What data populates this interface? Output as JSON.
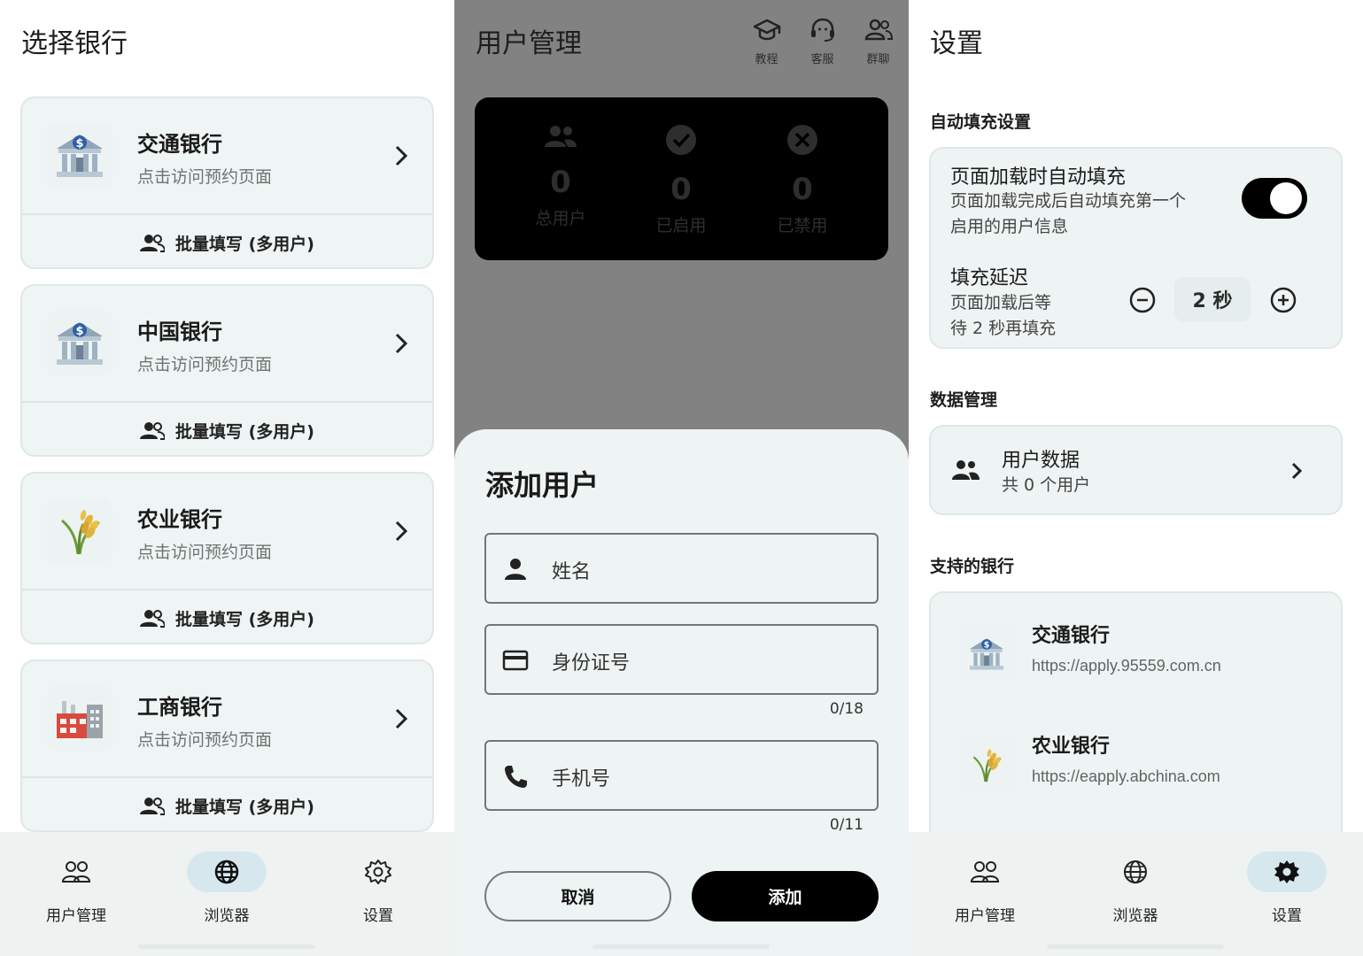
{
  "screen1": {
    "title": "选择银行",
    "banks": [
      {
        "name": "交通银行",
        "subtitle": "点击访问预约页面",
        "batch_label": "批量填写 (多用户)",
        "logo": "bank-building-icon"
      },
      {
        "name": "中国银行",
        "subtitle": "点击访问预约页面",
        "batch_label": "批量填写 (多用户)",
        "logo": "bank-building-icon"
      },
      {
        "name": "农业银行",
        "subtitle": "点击访问预约页面",
        "batch_label": "批量填写 (多用户)",
        "logo": "wheat-icon"
      },
      {
        "name": "工商银行",
        "subtitle": "点击访问预约页面",
        "batch_label": "批量填写 (多用户)",
        "logo": "factory-icon"
      }
    ],
    "nav": [
      {
        "label": "用户管理",
        "icon": "users-icon",
        "active": false
      },
      {
        "label": "浏览器",
        "icon": "globe-icon",
        "active": true
      },
      {
        "label": "设置",
        "icon": "gear-icon",
        "active": false
      }
    ]
  },
  "screen2": {
    "title": "用户管理",
    "actions": [
      {
        "label": "教程",
        "icon": "school-icon"
      },
      {
        "label": "客服",
        "icon": "headset-icon"
      },
      {
        "label": "群聊",
        "icon": "group-icon"
      }
    ],
    "stats": [
      {
        "value": "0",
        "label": "总用户",
        "icon": "people-icon"
      },
      {
        "value": "0",
        "label": "已启用",
        "icon": "check-circle-icon"
      },
      {
        "value": "0",
        "label": "已禁用",
        "icon": "x-circle-icon"
      }
    ],
    "sheet": {
      "title": "添加用户",
      "name_placeholder": "姓名",
      "id_placeholder": "身份证号",
      "id_counter": "0/18",
      "phone_placeholder": "手机号",
      "phone_counter": "0/11",
      "cancel_label": "取消",
      "add_label": "添加"
    }
  },
  "screen3": {
    "title": "设置",
    "autofill_section": "自动填充设置",
    "autofill_title": "页面加载时自动填充",
    "autofill_desc_1": "页面加载完成后自动填充第一个",
    "autofill_desc_2": "启用的用户信息",
    "autofill_enabled": true,
    "delay_title": "填充延迟",
    "delay_desc_1": "页面加载后等",
    "delay_desc_2": "待 2 秒再填充",
    "delay_value": "2 秒",
    "data_section": "数据管理",
    "user_data_title": "用户数据",
    "user_data_desc": "共 0 个用户",
    "supported_section": "支持的银行",
    "supported_banks": [
      {
        "name": "交通银行",
        "url": "https://apply.95559.com.cn",
        "logo": "bank-building-icon"
      },
      {
        "name": "农业银行",
        "url": "https://eapply.abchina.com",
        "logo": "wheat-icon"
      }
    ],
    "nav": [
      {
        "label": "用户管理",
        "icon": "users-icon",
        "active": false
      },
      {
        "label": "浏览器",
        "icon": "globe-icon",
        "active": false
      },
      {
        "label": "设置",
        "icon": "gear-icon",
        "active": true
      }
    ]
  },
  "colors": {
    "card_bg": "#eef5f4",
    "overlay": "#828282",
    "active_pill": "#d6e8ee",
    "primary": "#000000"
  }
}
